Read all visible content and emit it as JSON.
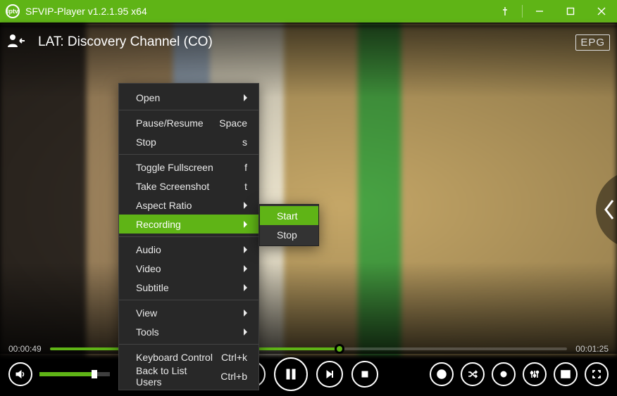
{
  "titlebar": {
    "title": "SFVIP-Player v1.2.1.95 x64"
  },
  "channel": {
    "title": "LAT: Discovery Channel (CO)",
    "epg": "EPG"
  },
  "time": {
    "current": "00:00:49",
    "total": "00:01:25"
  },
  "progress": {
    "percent": 56
  },
  "volume": {
    "percent": 78
  },
  "menu": {
    "open": "Open",
    "pauseResume": "Pause/Resume",
    "pauseResume_key": "Space",
    "stop": "Stop",
    "stop_key": "s",
    "toggleFullscreen": "Toggle Fullscreen",
    "toggleFullscreen_key": "f",
    "takeScreenshot": "Take Screenshot",
    "takeScreenshot_key": "t",
    "aspectRatio": "Aspect Ratio",
    "recording": "Recording",
    "audio": "Audio",
    "video": "Video",
    "subtitle": "Subtitle",
    "view": "View",
    "tools": "Tools",
    "keyboardControl": "Keyboard Control",
    "keyboardControl_key": "Ctrl+k",
    "backToList": "Back to List Users",
    "backToList_key": "Ctrl+b"
  },
  "submenu": {
    "start": "Start",
    "stop": "Stop"
  }
}
